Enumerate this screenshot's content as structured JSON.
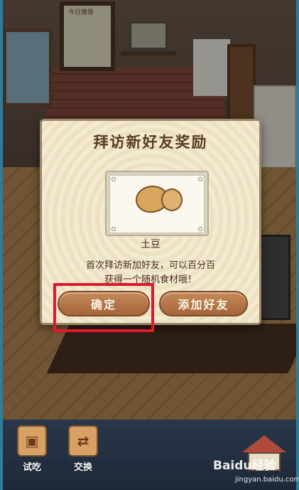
{
  "scene": {
    "board_text": "今日推荐"
  },
  "dialog": {
    "title": "拜访新好友奖励",
    "reward_item": {
      "name": "土豆",
      "icon": "potato-icon"
    },
    "description_line1": "首次拜访新加好友，可以百分百",
    "description_line2": "获得一个随机食材哦！",
    "confirm_label": "确定",
    "add_friend_label": "添加好友"
  },
  "highlight_color": "#e0192a",
  "bottom_bar": {
    "items": [
      {
        "label": "试吃",
        "icon": "tasting-box-icon"
      },
      {
        "label": "交换",
        "icon": "exchange-box-icon"
      }
    ],
    "home_icon": "house-icon"
  },
  "watermark": {
    "brand": "Baidu经验",
    "url": "jingyan.baidu.com"
  }
}
